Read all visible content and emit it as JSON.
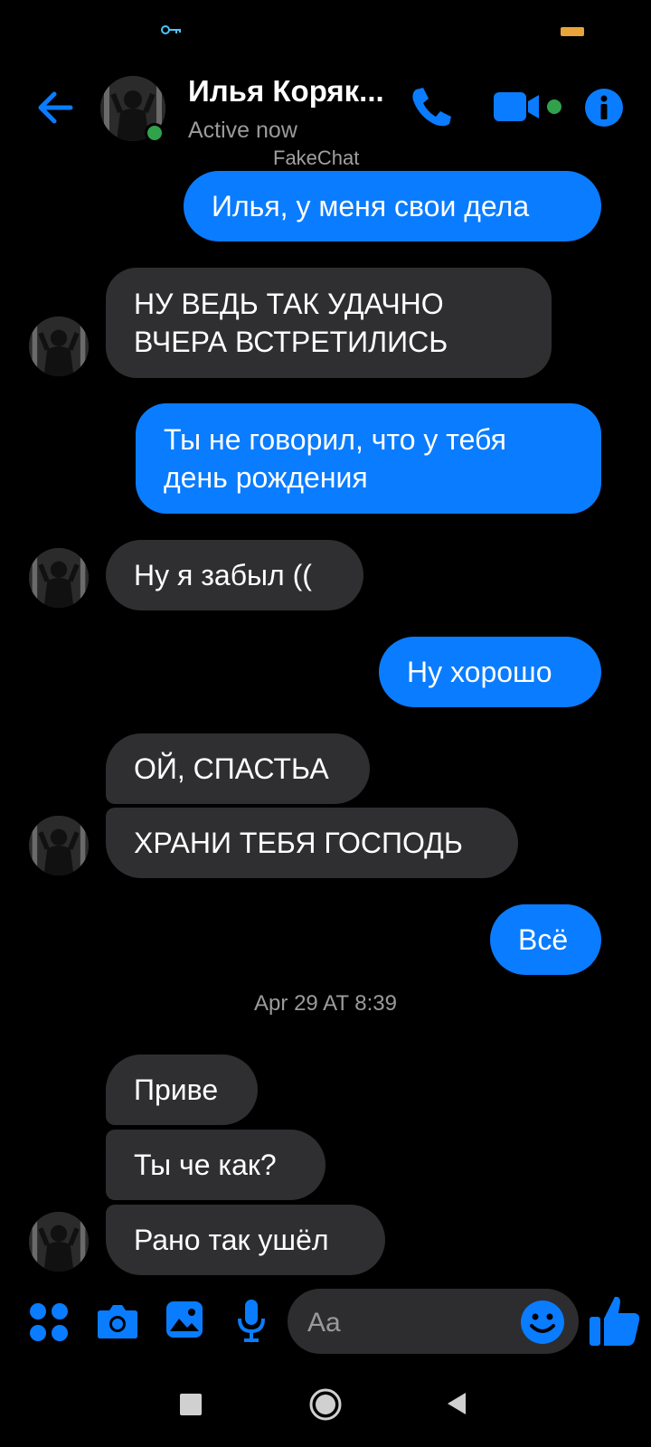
{
  "header": {
    "contact_name": "Илья Коряк...",
    "active_status": "Active now",
    "watermark": "FakeChat"
  },
  "messages": [
    {
      "text": "Илья, у меня свои дела",
      "direction": "outgoing"
    },
    {
      "text": "НУ ВЕДЬ ТАК УДАЧНО\nВЧЕРА ВСТРЕТИЛИСЬ",
      "direction": "incoming"
    },
    {
      "text": "Ты не говорил, что у тебя\nдень рождения",
      "direction": "outgoing"
    },
    {
      "text": "Ну я забыл ((",
      "direction": "incoming"
    },
    {
      "text": "Ну хорошо",
      "direction": "outgoing"
    },
    {
      "text": "ОЙ, СПАСТЬА",
      "direction": "incoming"
    },
    {
      "text": "ХРАНИ ТЕБЯ ГОСПОДЬ",
      "direction": "incoming"
    },
    {
      "text": "Всё",
      "direction": "outgoing"
    },
    {
      "text": "Приве",
      "direction": "incoming"
    },
    {
      "text": "Ты че как?",
      "direction": "incoming"
    },
    {
      "text": "Рано так ушёл",
      "direction": "incoming"
    }
  ],
  "timestamp": "Apr 29 AT 8:39",
  "composer": {
    "placeholder": "Aa"
  },
  "icons": [
    "back-arrow-icon",
    "phone-icon",
    "video-camera-icon",
    "info-icon",
    "apps-icon",
    "camera-icon",
    "gallery-icon",
    "microphone-icon",
    "emoji-icon",
    "thumbs-up-icon",
    "key-icon",
    "battery-icon",
    "square-icon",
    "home-circle-icon",
    "back-triangle-icon"
  ],
  "colors": {
    "accent": "#0a7cff",
    "incoming_bubble": "#2f2f31",
    "background": "#000000",
    "online": "#31a24c"
  }
}
